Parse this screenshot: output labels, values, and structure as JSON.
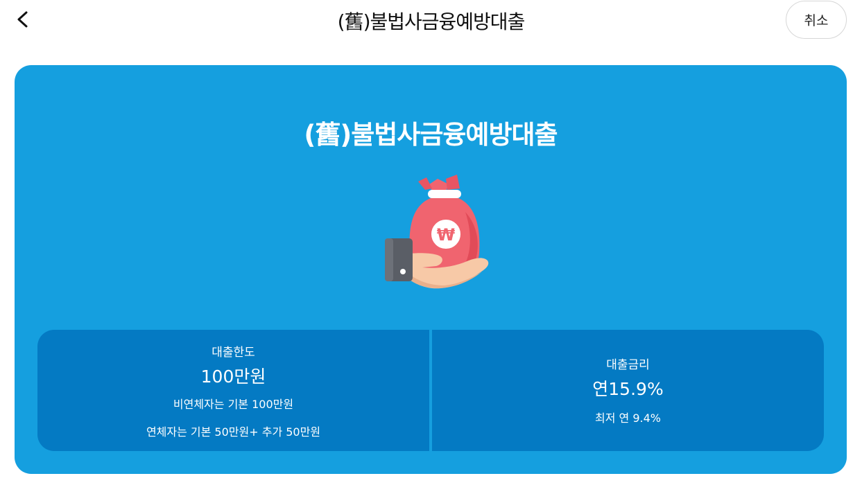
{
  "header": {
    "title": "(舊)불법사금융예방대출",
    "cancel_label": "취소"
  },
  "card": {
    "title": "(舊)불법사금융예방대출",
    "illustration_symbol": "₩",
    "colors": {
      "card_bg": "#159fdf",
      "panel_bg": "#047ac3",
      "bag": "#f0646f"
    }
  },
  "limit": {
    "label": "대출한도",
    "value": "100만원",
    "note1": "비연체자는 기본 100만원",
    "note2": "연체자는 기본 50만원+ 추가 50만원"
  },
  "rate": {
    "label": "대출금리",
    "value": "연15.9%",
    "note": "최저 연 9.4%"
  }
}
